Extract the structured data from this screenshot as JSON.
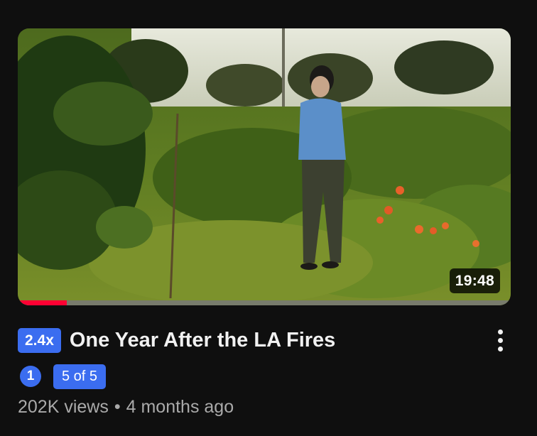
{
  "video": {
    "duration": "19:48",
    "watch_progress_fraction": 0.1,
    "speed": "2.4x",
    "title": "One Year After the LA Fires",
    "rank": "1",
    "playlist_position": "5 of 5",
    "views": "202K views",
    "separator": "•",
    "age": "4 months ago"
  },
  "icons": {
    "menu": "more-vert-icon",
    "rank": "number-one-icon"
  },
  "colors": {
    "background": "#0f0f0f",
    "accent_blue": "#3b6df0",
    "progress_red": "#ff0033",
    "title_text": "#f1f1f1",
    "meta_text": "#aaaaaa"
  }
}
